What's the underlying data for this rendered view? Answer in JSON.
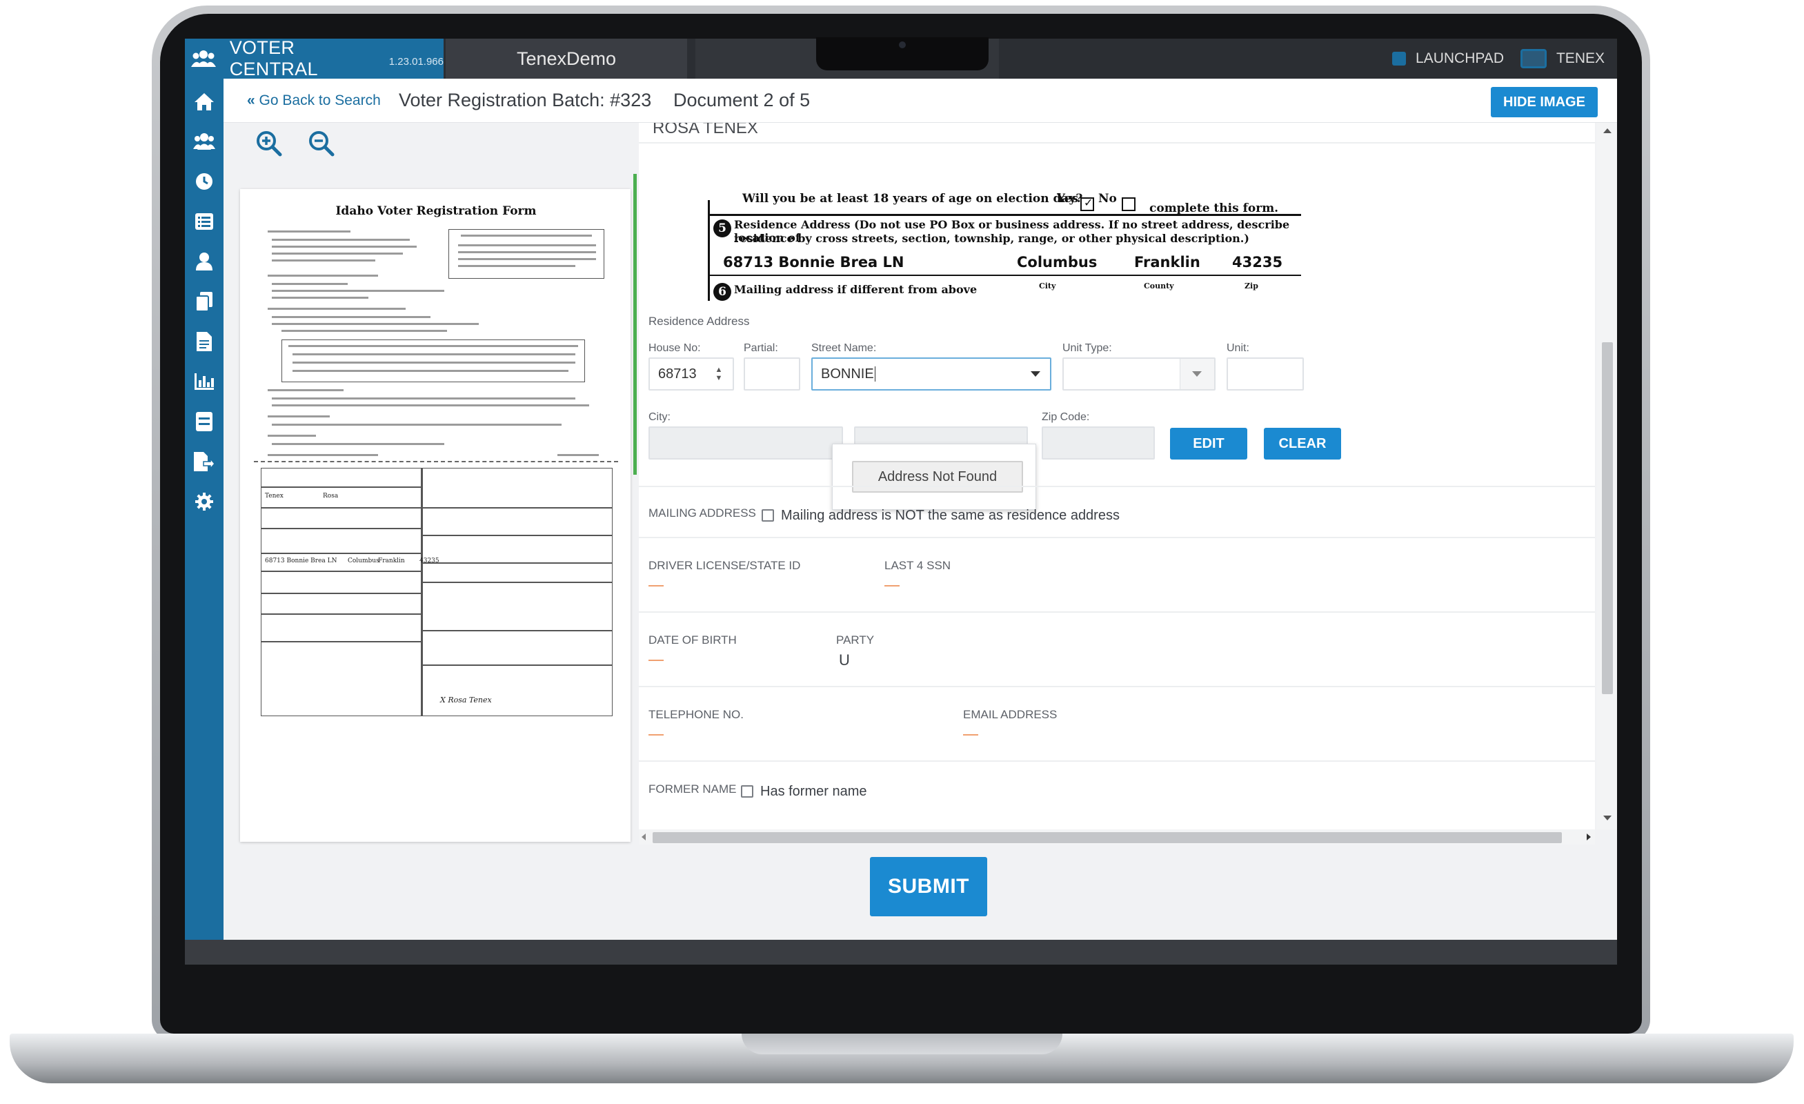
{
  "app": {
    "title": "VOTER CENTRAL",
    "version": "1.23.01.966",
    "tab_name": "TenexDemo",
    "launchpad_label": "LAUNCHPAD",
    "user_label": "TENEX"
  },
  "sidebar": {
    "items": [
      {
        "icon": "people-icon"
      },
      {
        "icon": "home-icon"
      },
      {
        "icon": "users-icon"
      },
      {
        "icon": "clock-icon"
      },
      {
        "icon": "list-icon"
      },
      {
        "icon": "user-icon"
      },
      {
        "icon": "documents-icon"
      },
      {
        "icon": "document-icon"
      },
      {
        "icon": "chart-icon"
      },
      {
        "icon": "notebook-icon"
      },
      {
        "icon": "export-icon"
      },
      {
        "icon": "gear-icon"
      }
    ]
  },
  "header": {
    "go_back": "Go Back to Search",
    "batch_title": "Voter Registration Batch: #323",
    "document_position": "Document 2 of 5",
    "hide_image": "HIDE IMAGE"
  },
  "image_pane": {
    "form_title": "Idaho Voter Registration Form"
  },
  "snippet": {
    "line_top": "Will you be at least 18 years of age on election day?",
    "yes": "Yes",
    "no": "No",
    "complete": "complete this form.",
    "num5": "5",
    "residence_text_1": "Residence Address (Do not use PO Box or business address. If no street address, describe location of",
    "residence_text_2": "residence by cross streets, section, township, range, or other physical description.)",
    "hand_address": "68713 Bonnie Brea LN",
    "hand_city": "Columbus",
    "hand_county": "Franklin",
    "hand_zip": "43235",
    "num6": "6",
    "mailing_text": "Mailing address if different from above",
    "city_caption": "City",
    "county_caption": "County",
    "zip_caption": "Zip"
  },
  "form": {
    "applicant_name": "ROSA TENEX",
    "residence_section": "Residence Address",
    "house_no_label": "House No:",
    "house_no_value": "68713",
    "partial_label": "Partial:",
    "partial_value": "",
    "street_name_label": "Street Name:",
    "street_name_value": "BONNIE",
    "unit_type_label": "Unit Type:",
    "unit_type_value": "",
    "unit_label": "Unit:",
    "unit_value": "",
    "city_label": "City:",
    "city_value": "",
    "zip_label": "Zip Code:",
    "zip_value": "",
    "edit": "EDIT",
    "clear": "CLEAR",
    "address_not_found": "Address Not Found",
    "mailing_label": "MAILING ADDRESS",
    "mailing_checkbox": "Mailing address is NOT the same as residence address",
    "dl_label": "DRIVER LICENSE/STATE ID",
    "dl_value": "—",
    "ssn_label": "LAST 4 SSN",
    "ssn_value": "—",
    "dob_label": "DATE OF BIRTH",
    "dob_value": "—",
    "party_label": "PARTY",
    "party_value": "U",
    "phone_label": "TELEPHONE NO.",
    "phone_value": "—",
    "email_label": "EMAIL ADDRESS",
    "email_value": "—",
    "former_label": "FORMER NAME",
    "former_checkbox": "Has former name"
  },
  "footer": {
    "submit": "SUBMIT"
  },
  "colors": {
    "brand_blue": "#1b6ea0",
    "button_blue": "#1b8ad1",
    "topbar_dark": "#2b2e33",
    "accent_green": "#4caf50"
  }
}
